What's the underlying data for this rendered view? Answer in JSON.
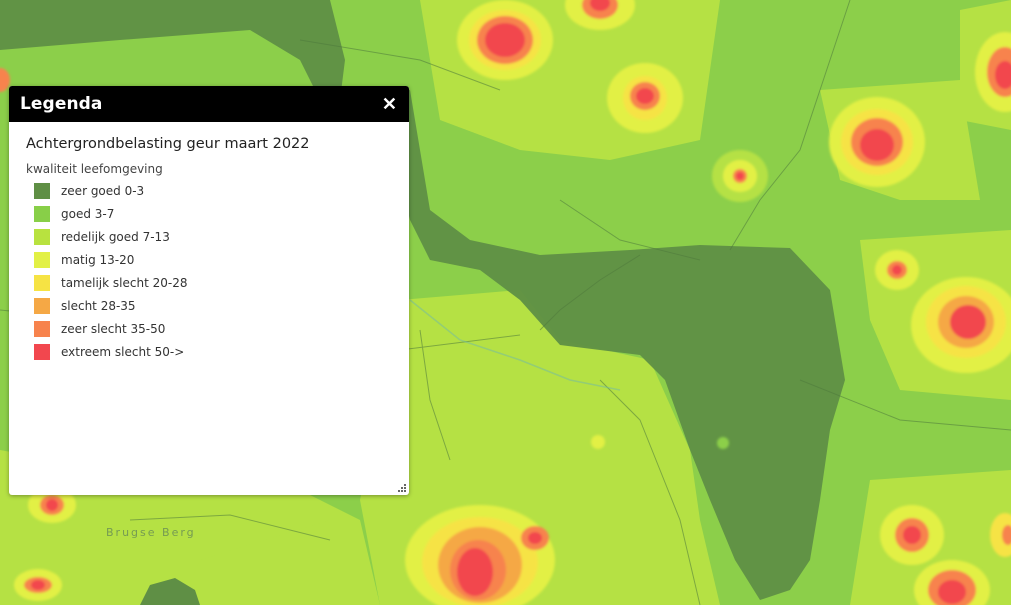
{
  "map": {
    "place_label": "Brugse Berg"
  },
  "legend": {
    "header_title": "Legenda",
    "close_icon": "close-icon",
    "layer_title": "Achtergrondbelasting geur maart 2022",
    "group_label": "kwaliteit leefomgeving",
    "items": [
      {
        "label": "zeer goed 0-3",
        "color": "#5f8f45"
      },
      {
        "label": "goed 3-7",
        "color": "#88cf48"
      },
      {
        "label": "redelijk goed 7-13",
        "color": "#b8e23f"
      },
      {
        "label": "matig 13-20",
        "color": "#e2f045"
      },
      {
        "label": "tamelijk slecht 20-28",
        "color": "#f6e344"
      },
      {
        "label": "slecht 28-35",
        "color": "#f5a845"
      },
      {
        "label": "zeer slecht 35-50",
        "color": "#f7834d"
      },
      {
        "label": "extreem slecht 50->",
        "color": "#f2474e"
      }
    ]
  }
}
